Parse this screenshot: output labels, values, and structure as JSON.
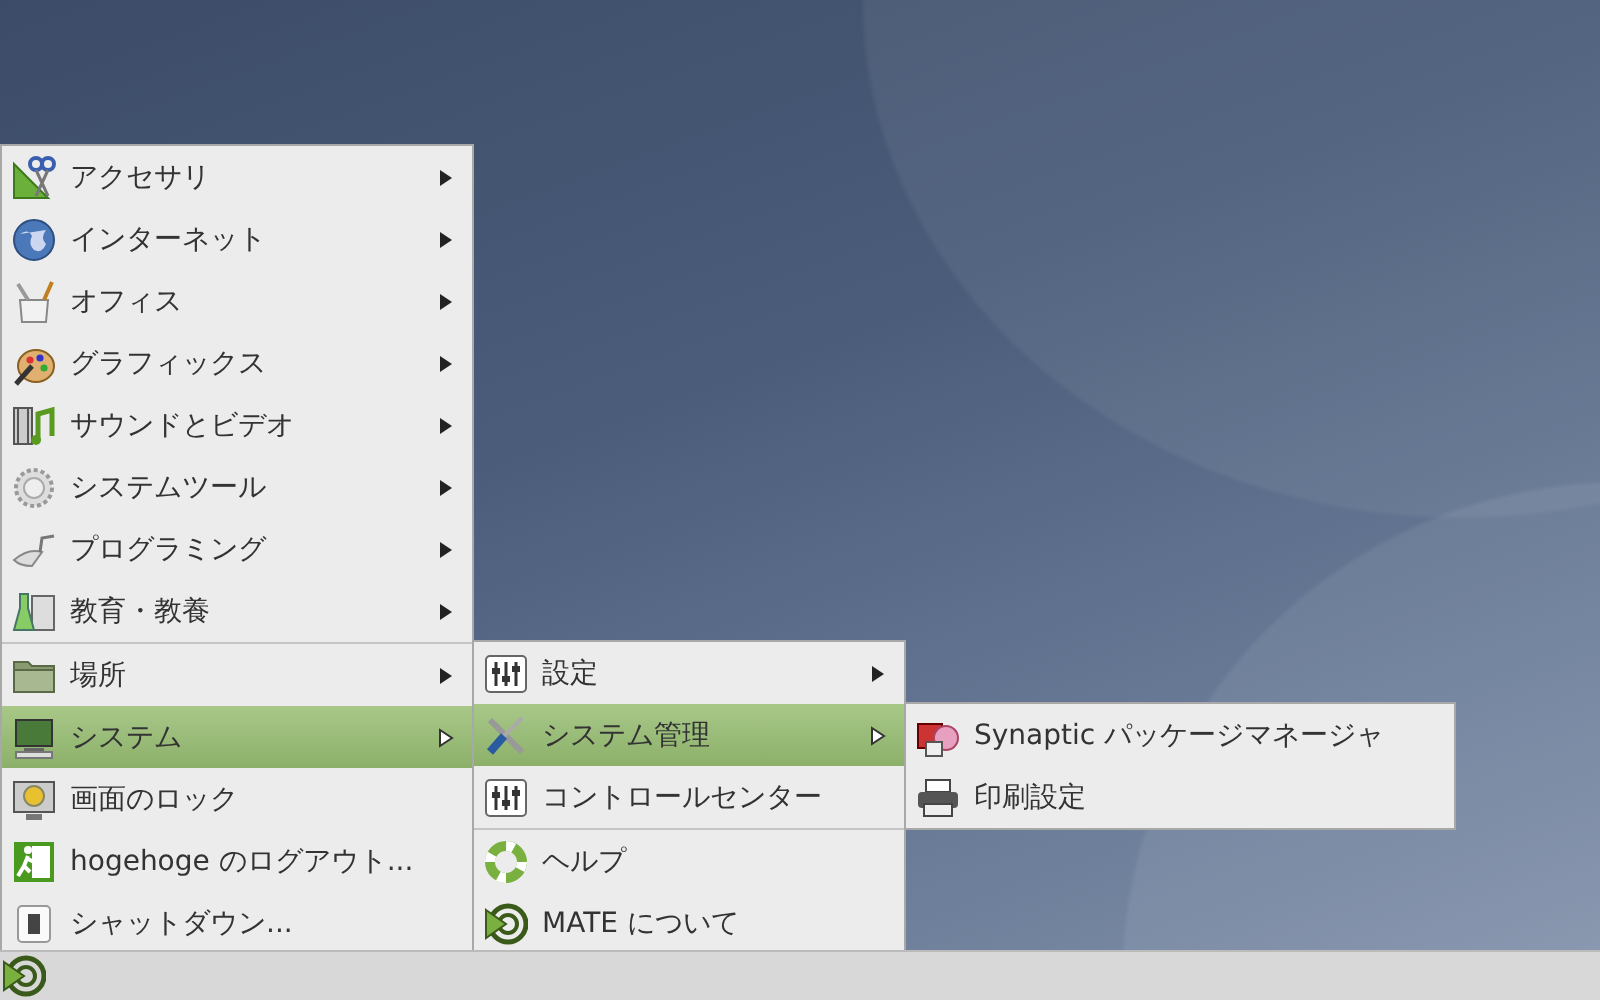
{
  "main_menu": {
    "items": [
      {
        "kind": "item",
        "label": "アクセサリ",
        "submenu": true,
        "selected": false
      },
      {
        "kind": "item",
        "label": "インターネット",
        "submenu": true,
        "selected": false
      },
      {
        "kind": "item",
        "label": "オフィス",
        "submenu": true,
        "selected": false
      },
      {
        "kind": "item",
        "label": "グラフィックス",
        "submenu": true,
        "selected": false
      },
      {
        "kind": "item",
        "label": "サウンドとビデオ",
        "submenu": true,
        "selected": false
      },
      {
        "kind": "item",
        "label": "システムツール",
        "submenu": true,
        "selected": false
      },
      {
        "kind": "item",
        "label": "プログラミング",
        "submenu": true,
        "selected": false
      },
      {
        "kind": "item",
        "label": "教育・教養",
        "submenu": true,
        "selected": false
      },
      {
        "kind": "separator"
      },
      {
        "kind": "item",
        "label": "場所",
        "submenu": true,
        "selected": false
      },
      {
        "kind": "item",
        "label": "システム",
        "submenu": true,
        "selected": true
      },
      {
        "kind": "item",
        "label": "画面のロック",
        "submenu": false,
        "selected": false
      },
      {
        "kind": "item",
        "label": "hogehoge のログアウト...",
        "submenu": false,
        "selected": false
      },
      {
        "kind": "item",
        "label": "シャットダウン...",
        "submenu": false,
        "selected": false
      }
    ]
  },
  "system_menu": {
    "items": [
      {
        "kind": "item",
        "label": "設定",
        "submenu": true,
        "selected": false
      },
      {
        "kind": "item",
        "label": "システム管理",
        "submenu": true,
        "selected": true
      },
      {
        "kind": "item",
        "label": "コントロールセンター",
        "submenu": false,
        "selected": false
      },
      {
        "kind": "separator"
      },
      {
        "kind": "item",
        "label": "ヘルプ",
        "submenu": false,
        "selected": false
      },
      {
        "kind": "item",
        "label": "MATE について",
        "submenu": false,
        "selected": false
      }
    ]
  },
  "admin_menu": {
    "items": [
      {
        "kind": "item",
        "label": "Synaptic パッケージマネージャ",
        "submenu": false,
        "selected": false
      },
      {
        "kind": "item",
        "label": "印刷設定",
        "submenu": false,
        "selected": false
      }
    ]
  }
}
